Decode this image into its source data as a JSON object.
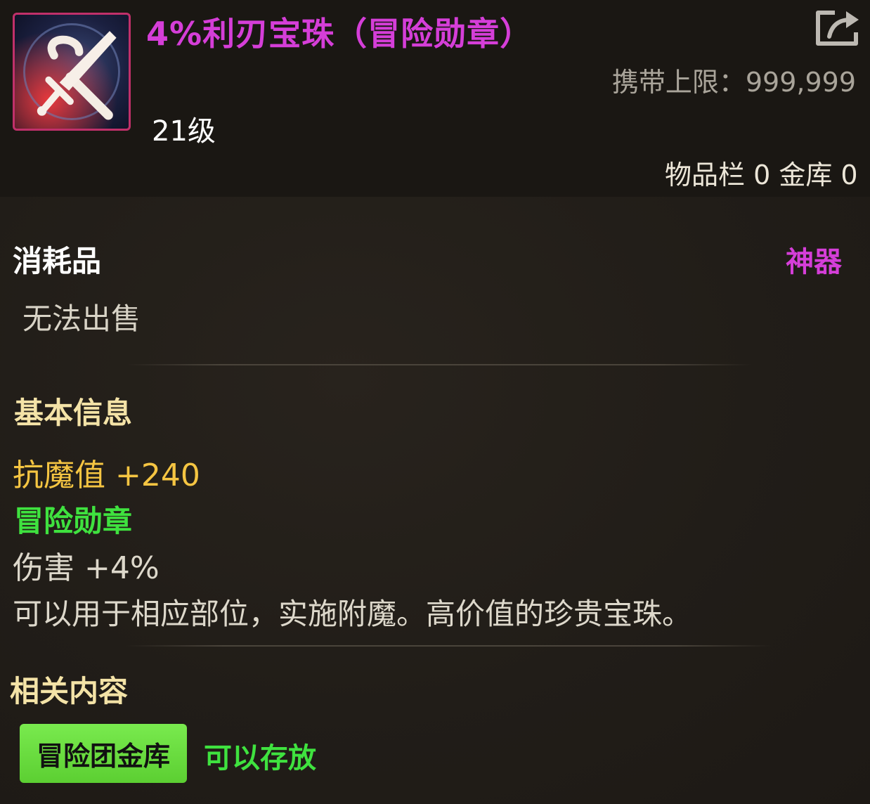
{
  "item": {
    "title": "4%利刃宝珠（冒险勋章）",
    "level": "21级",
    "icon": "sword-orb-icon",
    "title_color": "#d53ed8"
  },
  "header": {
    "carry_limit": "携带上限：999,999",
    "storage": "物品栏 0 金库 0",
    "export_icon": "share-export-icon"
  },
  "category": {
    "type": "消耗品",
    "rarity": "神器",
    "trade": "无法出售"
  },
  "basic_info": {
    "title": "基本信息",
    "stat": "抗魔值 +240",
    "medal_label": "冒险勋章",
    "damage": "伤害 +4%",
    "description": "可以用于相应部位，实施附魔。高价值的珍贵宝珠。"
  },
  "related": {
    "title": "相关内容",
    "button_label": "冒险团金库",
    "status": "可以存放"
  },
  "colors": {
    "rarity_purple": "#d53ed8",
    "stat_gold": "#f5c542",
    "medal_green": "#3fe23f",
    "button_green": "#5ccf32"
  }
}
